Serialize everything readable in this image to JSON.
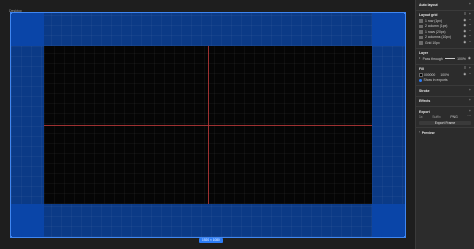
{
  "canvas": {
    "frame_label": "Desktop",
    "size_label": "1920 × 1080",
    "colors": {
      "frame_blue": "#0c3b8a",
      "selection": "#3f86f1",
      "center_guide": "#c23b3b"
    }
  },
  "panel": {
    "auto_layout": {
      "title": "Auto layout"
    },
    "layout_grid": {
      "title": "Layout grid",
      "items": [
        {
          "label": "1 row (1px)"
        },
        {
          "label": "2 column (1px)"
        },
        {
          "label": "1 rows (20px)"
        },
        {
          "label": "2 columns (10px)"
        },
        {
          "label": "Grid 10px"
        }
      ]
    },
    "layer": {
      "title": "Layer",
      "mode": "Pass through",
      "opacity": "100%",
      "opacity_fraction": 1.0
    },
    "fill": {
      "title": "Fill",
      "hex": "000000",
      "opacity": "100%",
      "show_in_exports": "Show in exports"
    },
    "stroke": {
      "title": "Stroke"
    },
    "effects": {
      "title": "Effects"
    },
    "export": {
      "title": "Export",
      "scale": "1x",
      "suffix": "Suffix",
      "format": "PNG",
      "button": "Export Frame"
    },
    "preview": {
      "title": "Preview"
    }
  }
}
